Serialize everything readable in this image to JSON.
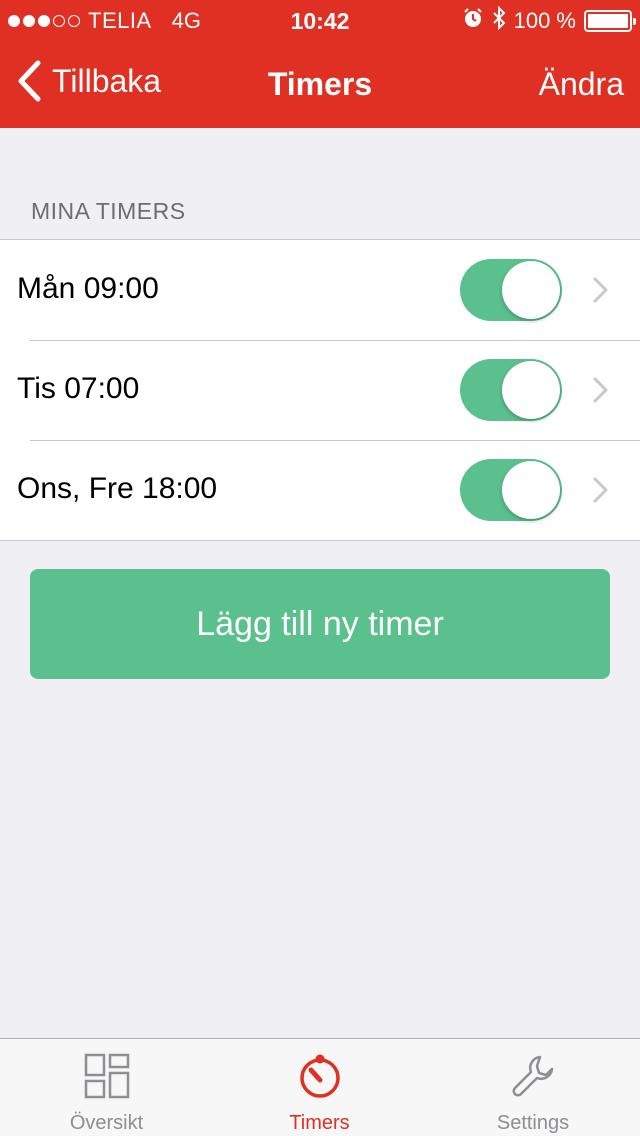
{
  "status_bar": {
    "carrier": "TELIA",
    "network": "4G",
    "time": "10:42",
    "battery": "100 %"
  },
  "nav": {
    "back_label": "Tillbaka",
    "title": "Timers",
    "edit_label": "Ändra"
  },
  "section": {
    "header": "MINA TIMERS"
  },
  "timers": [
    {
      "label": "Mån 09:00",
      "enabled": true
    },
    {
      "label": "Tis 07:00",
      "enabled": true
    },
    {
      "label": "Ons, Fre 18:00",
      "enabled": true
    }
  ],
  "add_button": {
    "label": "Lägg till ny timer"
  },
  "tabbar": {
    "tabs": [
      {
        "label": "Översikt",
        "icon": "grid-icon"
      },
      {
        "label": "Timers",
        "icon": "timer-icon"
      },
      {
        "label": "Settings",
        "icon": "wrench-icon"
      }
    ]
  },
  "colors": {
    "accent": "#e03024",
    "toggle_on": "#5ac18e",
    "button": "#5ac18e",
    "background": "#efeff4"
  }
}
